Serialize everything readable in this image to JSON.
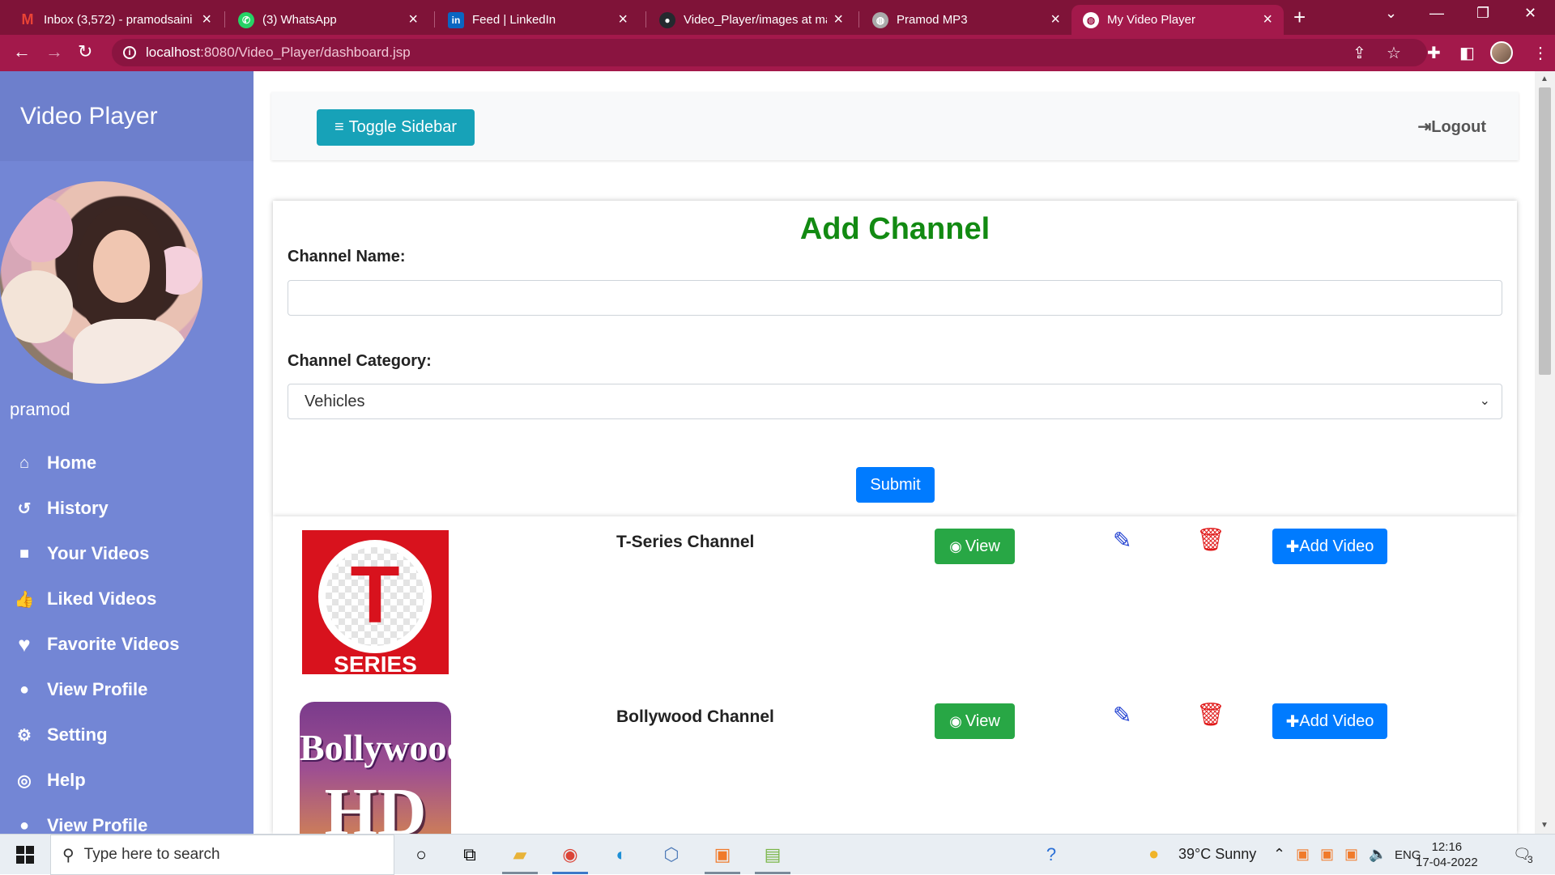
{
  "browser": {
    "tabs": [
      {
        "title": "Inbox (3,572) - pramodsaini",
        "favicon": "gmail-icon",
        "color": "#ea4335"
      },
      {
        "title": "(3) WhatsApp",
        "favicon": "whatsapp-icon",
        "color": "#25d366"
      },
      {
        "title": "Feed | LinkedIn",
        "favicon": "linkedin-icon",
        "color": "#0a66c2"
      },
      {
        "title": "Video_Player/images at main",
        "favicon": "github-icon",
        "color": "#24292e"
      },
      {
        "title": "Pramod MP3",
        "favicon": "globe-icon",
        "color": "#aaaaaa"
      },
      {
        "title": "My Video Player",
        "favicon": "globe-icon",
        "color": "#ffffff"
      }
    ],
    "url_host": "localhost",
    "url_path": ":8080/Video_Player/dashboard.jsp"
  },
  "sidebar": {
    "title": "Video Player",
    "username": "pramod",
    "items": [
      {
        "label": "Home",
        "icon": "home-icon",
        "glyph": "⌂"
      },
      {
        "label": "History",
        "icon": "history-icon",
        "glyph": "↺"
      },
      {
        "label": "Your Videos",
        "icon": "video-camera-icon",
        "glyph": "■"
      },
      {
        "label": "Liked Videos",
        "icon": "thumbs-up-icon",
        "glyph": "👍"
      },
      {
        "label": "Favorite Videos",
        "icon": "heart-icon",
        "glyph": "♥"
      },
      {
        "label": "View Profile",
        "icon": "user-icon",
        "glyph": "●"
      },
      {
        "label": "Setting",
        "icon": "gear-icon",
        "glyph": "⚙"
      },
      {
        "label": "Help",
        "icon": "life-ring-icon",
        "glyph": "◎"
      },
      {
        "label": "View Profile",
        "icon": "user-icon",
        "glyph": "●"
      }
    ]
  },
  "topnav": {
    "toggle_label": "Toggle Sidebar",
    "logout_label": "Logout"
  },
  "form": {
    "title": "Add Channel",
    "channel_name_label": "Channel Name:",
    "channel_name_value": "",
    "channel_category_label": "Channel Category:",
    "channel_category_value": "Vehicles",
    "submit_label": "Submit"
  },
  "channels": [
    {
      "name": "T-Series Channel",
      "thumb_text": "T",
      "thumb_sub": "SERIES",
      "view_label": "View",
      "add_label": "Add Video"
    },
    {
      "name": "Bollywood Channel",
      "thumb_text": "Bollywood",
      "thumb_sub": "HD",
      "view_label": "View",
      "add_label": "Add Video"
    }
  ],
  "taskbar": {
    "search_placeholder": "Type here to search",
    "weather": "39°C  Sunny",
    "language": "ENG",
    "time": "12:16",
    "date": "17-04-2022",
    "notifications": "3"
  },
  "colors": {
    "sidebar": "#7386d5",
    "sidebar_header": "#6d7fcc",
    "form_title": "#128a12",
    "primary": "#007bff",
    "success": "#28a745",
    "info": "#17a2b8",
    "danger": "#e01a1a",
    "browser_frame": "#a3194b"
  }
}
